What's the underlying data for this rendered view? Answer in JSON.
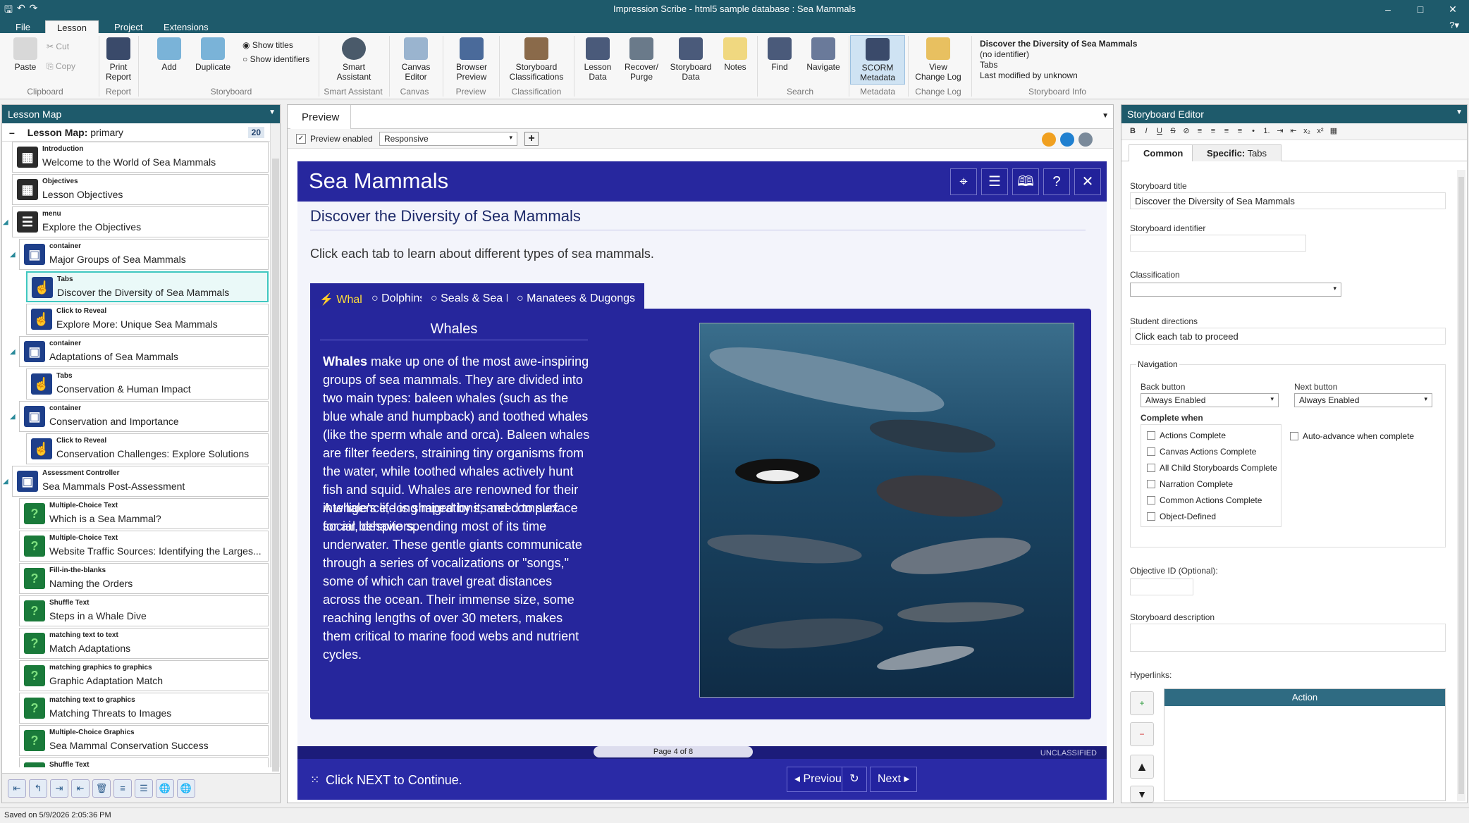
{
  "window": {
    "title": "Impression Scribe - html5 sample database : Sea Mammals"
  },
  "ribbon_tabs": [
    "File",
    "Lesson",
    "Project",
    "Extensions"
  ],
  "ribbon": {
    "clipboard": {
      "paste": "Paste",
      "cut": "Cut",
      "copy": "Copy",
      "group": "Clipboard"
    },
    "report": {
      "print": "Print Report",
      "group": "Report"
    },
    "storyboard": {
      "add": "Add",
      "duplicate": "Duplicate",
      "show_titles": "Show titles",
      "show_identifiers": "Show identifiers",
      "group": "Storyboard"
    },
    "smart": {
      "label": "Smart Assistant",
      "group": "Smart Assistant"
    },
    "canvas": {
      "label": "Canvas Editor",
      "group": "Canvas"
    },
    "preview": {
      "label": "Browser Preview",
      "group": "Preview"
    },
    "classification": {
      "label": "Storyboard Classifications",
      "group": "Classification"
    },
    "data": {
      "lesson": "Lesson Data",
      "recover": "Recover/ Purge",
      "storyboard": "Storyboard Data",
      "notes": "Notes"
    },
    "search": {
      "find": "Find",
      "navigate": "Navigate",
      "group": "Search"
    },
    "metadata": {
      "label": "SCORM Metadata",
      "group": "Metadata"
    },
    "changelog": {
      "label": "View Change Log",
      "group": "Change Log"
    },
    "info": {
      "title": "Discover the Diversity of Sea Mammals",
      "identifier": "(no identifier)",
      "type": "Tabs",
      "modified": "Last modified by unknown",
      "group": "Storyboard Info"
    }
  },
  "lesson_map": {
    "header": "Lesson Map",
    "label": "Lesson Map:",
    "name": "primary",
    "count": "20",
    "items": [
      {
        "type": "Introduction",
        "name": "Welcome to the World of Sea Mammals",
        "icon": "grid-icon",
        "color": "#2b2b2b"
      },
      {
        "type": "Objectives",
        "name": "Lesson Objectives",
        "icon": "grid-icon",
        "color": "#2b2b2b"
      },
      {
        "type": "menu",
        "name": "Explore the Objectives",
        "icon": "menu-icon",
        "color": "#2b2b2b"
      },
      {
        "type": "container",
        "name": "Major Groups of Sea Mammals",
        "icon": "cube-icon",
        "color": "#1e3f8a"
      },
      {
        "type": "Tabs",
        "name": "Discover the Diversity of Sea Mammals",
        "icon": "hand-icon",
        "color": "#1e3f8a"
      },
      {
        "type": "Click to Reveal",
        "name": "Explore More: Unique Sea Mammals",
        "icon": "hand-icon",
        "color": "#1e3f8a"
      },
      {
        "type": "container",
        "name": "Adaptations of Sea Mammals",
        "icon": "cube-icon",
        "color": "#1e3f8a"
      },
      {
        "type": "Tabs",
        "name": "Conservation & Human Impact",
        "icon": "hand-icon",
        "color": "#1e3f8a"
      },
      {
        "type": "container",
        "name": "Conservation and Importance",
        "icon": "cube-icon",
        "color": "#1e3f8a"
      },
      {
        "type": "Click to Reveal",
        "name": "Conservation Challenges: Explore Solutions",
        "icon": "hand-icon",
        "color": "#1e3f8a"
      },
      {
        "type": "Assessment Controller",
        "name": "Sea Mammals Post-Assessment",
        "icon": "cube-icon",
        "color": "#1e3f8a"
      },
      {
        "type": "Multiple-Choice Text",
        "name": "Which is a Sea Mammal?",
        "icon": "question-icon",
        "color": "#1a7a3a"
      },
      {
        "type": "Multiple-Choice Text",
        "name": "Website Traffic Sources: Identifying the Larges...",
        "icon": "question-icon",
        "color": "#1a7a3a"
      },
      {
        "type": "Fill-in-the-blanks",
        "name": "Naming the Orders",
        "icon": "question-icon",
        "color": "#1a7a3a"
      },
      {
        "type": "Shuffle Text",
        "name": "Steps in a Whale Dive",
        "icon": "question-icon",
        "color": "#1a7a3a"
      },
      {
        "type": "matching text to text",
        "name": "Match Adaptations",
        "icon": "question-icon",
        "color": "#1a7a3a"
      },
      {
        "type": "matching graphics to graphics",
        "name": "Graphic Adaptation Match",
        "icon": "question-icon",
        "color": "#1a7a3a"
      },
      {
        "type": "matching text to graphics",
        "name": "Matching Threats to Images",
        "icon": "question-icon",
        "color": "#1a7a3a"
      },
      {
        "type": "Multiple-Choice Graphics",
        "name": "Sea Mammal Conservation Success",
        "icon": "question-icon",
        "color": "#1a7a3a"
      },
      {
        "type": "Shuffle Text",
        "name": "",
        "icon": "question-icon",
        "color": "#1a7a3a"
      }
    ]
  },
  "preview": {
    "tab": "Preview",
    "enabled_label": "Preview enabled",
    "mode": "Responsive",
    "course_title": "Sea Mammals",
    "subtitle": "Discover the Diversity of Sea Mammals",
    "directions": "Click each tab to learn about different types of sea mammals.",
    "tabs": [
      "Whales",
      "Dolphins",
      "Seals & Sea Lions",
      "Manatees & Dugongs"
    ],
    "panel_heading": "Whales",
    "para1_bold": "Whales",
    "para1": " make up one of the most awe-inspiring groups of sea mammals. They are divided into two main types: baleen whales (such as the blue whale and humpback) and toothed whales (like the sperm whale and orca). Baleen whales are filter feeders, straining tiny organisms from the water, while toothed whales actively hunt fish and squid. Whales are renowned for their intelligence, long migrations, and complex social behaviors.",
    "para2": "A whale's life is shaped by its need to surface for air, despite spending most of its time underwater. These gentle giants communicate through a series of vocalizations or \"songs,\" some of which can travel great distances across the ocean. Their immense size, some reaching lengths of over 30 meters, makes them critical to marine food webs and nutrient cycles.",
    "page": "Page 4 of 8",
    "classification": "UNCLASSIFIED",
    "continue": "Click NEXT to Continue.",
    "previous": "Previous",
    "next": "Next"
  },
  "editor": {
    "header": "Storyboard Editor",
    "tab_common": "Common",
    "tab_specific": "Specific:",
    "tab_specific_type": "Tabs",
    "title_label": "Storyboard title",
    "title": "Discover the Diversity of Sea Mammals",
    "identifier_label": "Storyboard identifier",
    "classification_label": "Classification",
    "directions_label": "Student directions",
    "directions": "Click each tab to proceed",
    "navigation": "Navigation",
    "back_label": "Back button",
    "back": "Always Enabled",
    "next_label": "Next button",
    "next": "Always Enabled",
    "complete_when": "Complete when",
    "complete_options": [
      "Actions Complete",
      "Canvas Actions Complete",
      "All Child Storyboards Complete",
      "Narration Complete",
      "Common Actions Complete",
      "Object-Defined"
    ],
    "auto_advance": "Auto-advance when complete",
    "objective_label": "Objective ID (Optional):",
    "description_label": "Storyboard description",
    "hyperlinks_label": "Hyperlinks:",
    "action_header": "Action"
  },
  "status": "Saved on 5/9/2026 2:05:36 PM"
}
